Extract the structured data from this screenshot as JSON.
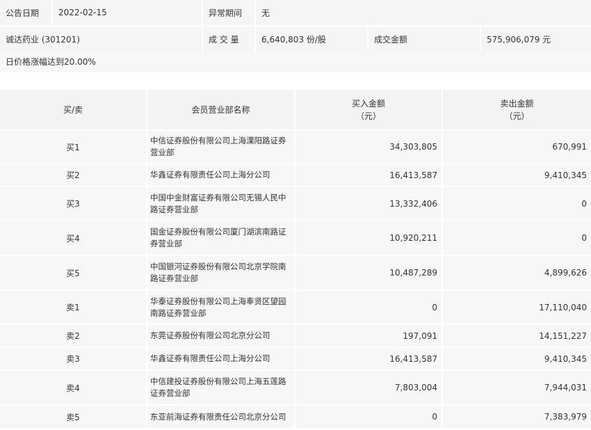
{
  "header": {
    "date_label": "公告日期",
    "date_value": "2022-02-15",
    "period_label": "异常期间",
    "period_value": "无",
    "stock_name": "诚达药业 (301201)",
    "volume_label": "成 交 量",
    "volume_value": "6,640,803 份/股",
    "amount_label": "成交金额",
    "amount_value": "575,906,079 元"
  },
  "note": "日价格涨幅达到20.00%",
  "table": {
    "headers": {
      "side": "买/卖",
      "name": "会员营业部名称",
      "buy_line1": "买入金额",
      "buy_line2": "（元）",
      "sell_line1": "卖出金额",
      "sell_line2": "（元）"
    },
    "rows": [
      {
        "side": "买1",
        "name": "中信证券股份有限公司上海溧阳路证券营业部",
        "buy": "34,303,805",
        "sell": "670,991"
      },
      {
        "side": "买2",
        "name": "华鑫证券有限责任公司上海分公司",
        "buy": "16,413,587",
        "sell": "9,410,345"
      },
      {
        "side": "买3",
        "name": "中国中金财富证券有限公司无锡人民中路证券营业部",
        "buy": "13,332,406",
        "sell": "0"
      },
      {
        "side": "买4",
        "name": "国金证券股份有限公司厦门湖滨南路证券营业部",
        "buy": "10,920,211",
        "sell": "0"
      },
      {
        "side": "买5",
        "name": "中国银河证券股份有限公司北京学院南路证券营业部",
        "buy": "10,487,289",
        "sell": "4,899,626"
      },
      {
        "side": "卖1",
        "name": "华泰证券股份有限公司上海奉贤区望园南路证券营业部",
        "buy": "0",
        "sell": "17,110,040"
      },
      {
        "side": "卖2",
        "name": "东莞证券股份有限公司北京分公司",
        "buy": "197,091",
        "sell": "14,151,227"
      },
      {
        "side": "卖3",
        "name": "华鑫证券有限责任公司上海分公司",
        "buy": "16,413,587",
        "sell": "9,410,345"
      },
      {
        "side": "卖4",
        "name": "中信建投证券股份有限公司上海五莲路证券营业部",
        "buy": "7,803,004",
        "sell": "7,944,031"
      },
      {
        "side": "卖5",
        "name": "东亚前海证券有限责任公司北京分公司",
        "buy": "0",
        "sell": "7,383,979"
      }
    ]
  }
}
